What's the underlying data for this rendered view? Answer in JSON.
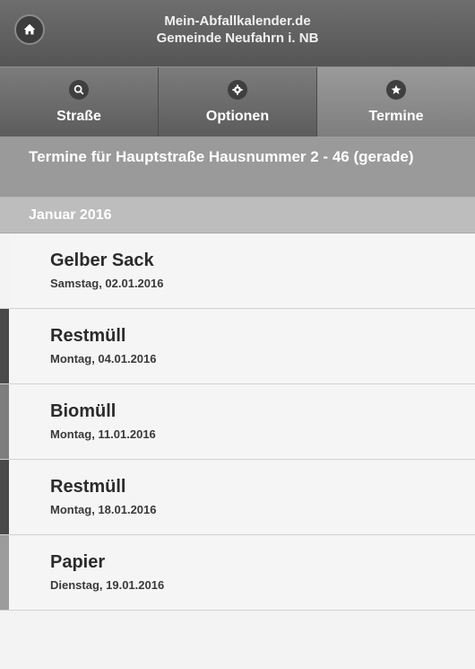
{
  "header": {
    "title": "Mein-Abfallkalender.de",
    "subtitle": "Gemeinde Neufahrn i. NB"
  },
  "tabs": [
    {
      "label": "Straße",
      "icon": "search-icon",
      "active": false
    },
    {
      "label": "Optionen",
      "icon": "gear-icon",
      "active": false
    },
    {
      "label": "Termine",
      "icon": "star-icon",
      "active": true
    }
  ],
  "info": {
    "text": "Termine für Hauptstraße Hausnummer 2 - 46 (gerade)"
  },
  "month": {
    "label": "Januar 2016"
  },
  "entries": [
    {
      "title": "Gelber Sack",
      "date": "Samstag, 02.01.2016",
      "color": "#f3f3f3"
    },
    {
      "title": "Restmüll",
      "date": "Montag, 04.01.2016",
      "color": "#4a4a4a"
    },
    {
      "title": "Biomüll",
      "date": "Montag, 11.01.2016",
      "color": "#7e7e7e"
    },
    {
      "title": "Restmüll",
      "date": "Montag, 18.01.2016",
      "color": "#4a4a4a"
    },
    {
      "title": "Papier",
      "date": "Dienstag, 19.01.2016",
      "color": "#9c9c9c"
    }
  ]
}
